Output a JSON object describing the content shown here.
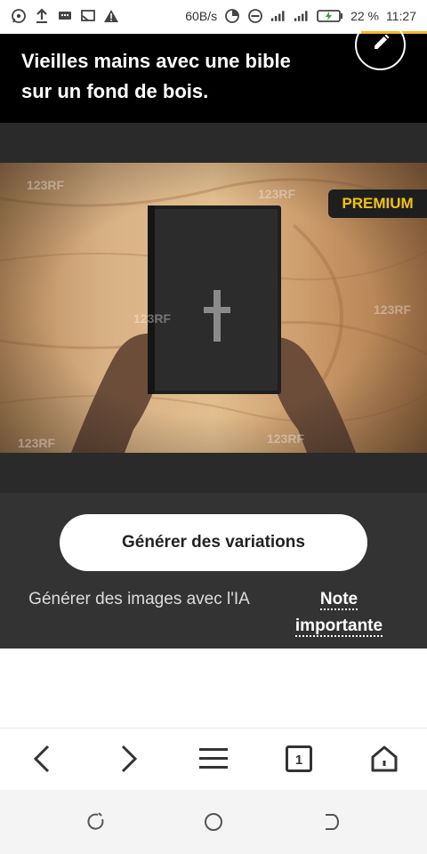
{
  "status_bar": {
    "net_speed": "60B/s",
    "battery": "22 %",
    "time": "11:27",
    "icons": [
      "whatsapp-icon",
      "upload-icon",
      "message-icon",
      "cast-icon",
      "warning-icon",
      "data-saver-icon",
      "dnd-icon",
      "signal-icon",
      "signal-icon",
      "battery-icon"
    ]
  },
  "header": {
    "title": "Vieilles mains avec une bible sur un fond de bois.",
    "edit_icon": "pencil-icon"
  },
  "image": {
    "badge": "PREMIUM",
    "watermark": "123RF"
  },
  "actions": {
    "generate_variations": "Générer des variations",
    "generate_ai": "Générer des images avec l'IA",
    "note": "Note importante"
  },
  "browser_nav": {
    "tab_count": "1",
    "icons": [
      "back-icon",
      "forward-icon",
      "menu-icon",
      "tabs-icon",
      "home-icon"
    ]
  },
  "system_nav": {
    "icons": [
      "recent-icon",
      "home-circle-icon",
      "back-icon"
    ]
  },
  "colors": {
    "header_bg": "#000000",
    "badge_text": "#f5c400",
    "controls_bg": "#333333",
    "accent_line": "#f5b731"
  }
}
